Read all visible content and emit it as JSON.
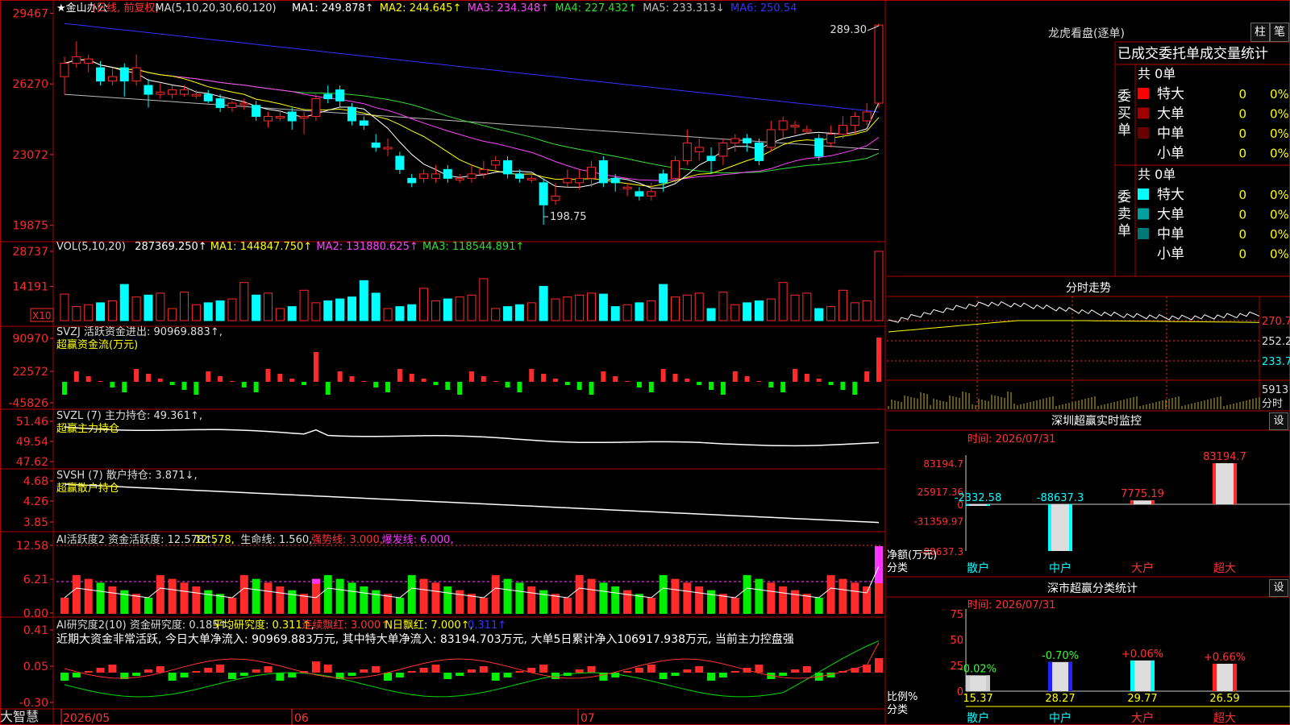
{
  "main": {
    "title": "★金山办公",
    "mode": "(日线, 前复权)",
    "ma_header": "MA(5,10,20,30,60,120)",
    "ma_values": [
      {
        "text": "MA1: 249.878↑",
        "color": "#ffffff"
      },
      {
        "text": "MA2: 244.645↑",
        "color": "#ffff00"
      },
      {
        "text": "MA3: 234.348↑",
        "color": "#ff44ff"
      },
      {
        "text": "MA4: 227.432↑",
        "color": "#33dd33"
      },
      {
        "text": "MA5: 233.313↓",
        "color": "#bbbbbb"
      },
      {
        "text": "MA6: 250.54",
        "color": "#3333ff"
      }
    ],
    "y_ticks": [
      "29467",
      "26270",
      "23072",
      "19875"
    ],
    "high_label": "289.30",
    "low_label": "198.75"
  },
  "volume": {
    "header": "VOL(5,10,20)",
    "values": [
      {
        "text": "287369.250↑",
        "color": "#ffffff"
      },
      {
        "text": "MA1: 144847.750↑",
        "color": "#ffff00"
      },
      {
        "text": "MA2: 131880.625↑",
        "color": "#ff44ff"
      },
      {
        "text": "MA3: 118544.891↑",
        "color": "#33dd33"
      }
    ],
    "y_ticks": [
      "28737",
      "14191"
    ],
    "unit": "X10"
  },
  "svzj": {
    "title": "SVZJ  活跃资金进出: 90969.883↑,",
    "subtitle": "超赢资金流(万元)",
    "y_ticks": [
      "90970",
      "22572",
      "-45826"
    ]
  },
  "svzl": {
    "title": "SVZL (7) 主力持仓: 49.361↑,",
    "subtitle": "超赢主力持仓",
    "y_ticks": [
      "51.46",
      "49.54",
      "47.62"
    ]
  },
  "svsh": {
    "title": "SVSH (7) 散户持仓: 3.871↓,",
    "subtitle": "超赢散户持仓",
    "y_ticks": [
      "4.68",
      "4.26",
      "3.85"
    ]
  },
  "ai_active": {
    "title": "AI活跃度2 资金活跃度: 12.578↑,",
    "v2": "12.578,",
    "v3": "生命线: 1.560,",
    "v4": "强势线: 3.000,",
    "v5": "爆发线: 6.000,",
    "y_ticks": [
      "12.58",
      "6.21",
      "0.00"
    ]
  },
  "ai_research": {
    "title": "AI研究度2(10) 资金研究度: 0.185↑,",
    "v2": "平均研究度: 0.311↑,",
    "v3": "连续飘红: 3.000↑,",
    "v4": "N日飘红: 7.000↑,",
    "v5": "0.311↑",
    "note": "近期大资金非常活跃, 今日大单净流入: 90969.883万元, 其中特大单净流入: 83194.703万元, 大单5日累计净入106917.938万元, 当前主力控盘强",
    "y_ticks": [
      "0.41",
      "0.05",
      "-0.30"
    ]
  },
  "x_axis": {
    "labels": [
      "2026/05",
      "06",
      "07"
    ],
    "brand": "大智慧"
  },
  "right": {
    "lhb_title": "龙虎看盘(逐单)",
    "btn1": "柱",
    "btn2": "笔",
    "stat_header": "已成交委托单成交量统计",
    "buy_label": "委买单",
    "sell_label": "委卖单",
    "buy_total": "共 0单",
    "sell_total": "共 0单",
    "buy_rows": [
      {
        "label": "特大",
        "v": "0",
        "p": "0%",
        "color": "#ff0000"
      },
      {
        "label": "大单",
        "v": "0",
        "p": "0%",
        "color": "#a00000"
      },
      {
        "label": "中单",
        "v": "0",
        "p": "0%",
        "color": "#6a0000"
      },
      {
        "label": "小单",
        "v": "0",
        "p": "0%",
        "color": ""
      }
    ],
    "sell_rows": [
      {
        "label": "特大",
        "v": "0",
        "p": "0%",
        "color": "#00ffff"
      },
      {
        "label": "大单",
        "v": "0",
        "p": "0%",
        "color": "#00a0a0"
      },
      {
        "label": "中单",
        "v": "0",
        "p": "0%",
        "color": "#007878"
      },
      {
        "label": "小单",
        "v": "0",
        "p": "0%",
        "color": ""
      }
    ],
    "intraday": {
      "title": "分时走势",
      "ticks": [
        "270.7",
        "252.2",
        "233.7"
      ],
      "vol": "5913",
      "vol_unit": "分时"
    },
    "sz_monitor": {
      "title": "深圳超赢实时监控",
      "btn": "设",
      "time": "时间: 2026/07/31",
      "y_ticks": [
        "83194.7",
        "25917.36",
        "0",
        "-31359.97",
        "-88637.3"
      ],
      "bars": [
        {
          "cat": "散户",
          "v": -2332.58,
          "label": "-2332.58"
        },
        {
          "cat": "中户",
          "v": -88637.3,
          "label": "-88637.3"
        },
        {
          "cat": "大户",
          "v": 7775.19,
          "label": "7775.19"
        },
        {
          "cat": "超大",
          "v": 83194.7,
          "label": "83194.7"
        }
      ],
      "ylabel": "净额(万元)",
      "xlabel": "分类"
    },
    "sz_classify": {
      "title": "深市超赢分类统计",
      "btn": "设",
      "time": "时间: 2026/07/31",
      "y_ticks": [
        "75",
        "50",
        "25",
        "0"
      ],
      "bars": [
        {
          "cat": "散户",
          "v": 15.37,
          "label": "15.37",
          "chg": "-0.02%",
          "chg_color": "#33ff33",
          "color": "#cccccc"
        },
        {
          "cat": "中户",
          "v": 28.27,
          "label": "28.27",
          "chg": "-0.70%",
          "chg_color": "#33ff33",
          "color": "#2222ff"
        },
        {
          "cat": "大户",
          "v": 29.77,
          "label": "29.77",
          "chg": "+0.06%",
          "chg_color": "#ff3333",
          "color": "#00ffff"
        },
        {
          "cat": "超大",
          "v": 26.59,
          "label": "26.59",
          "chg": "+0.66%",
          "chg_color": "#ff3333",
          "color": "#ff2222"
        }
      ],
      "ylabel": "比例%",
      "xlabel": "分类"
    }
  },
  "chart_data": {
    "type": "candlestick",
    "x_labels": [
      "2026/05",
      "06",
      "07"
    ],
    "price_ylim": [
      198.75,
      294.67
    ],
    "candles": [
      {
        "o": 266,
        "c": 272,
        "h": 275,
        "l": 258
      },
      {
        "o": 272,
        "c": 275,
        "h": 282,
        "l": 270
      },
      {
        "o": 272,
        "c": 274,
        "h": 276,
        "l": 268
      },
      {
        "o": 270,
        "c": 264,
        "h": 273,
        "l": 262
      },
      {
        "o": 264,
        "c": 266,
        "h": 270,
        "l": 262
      },
      {
        "o": 270,
        "c": 264,
        "h": 272,
        "l": 257
      },
      {
        "o": 264,
        "c": 270,
        "h": 276,
        "l": 262
      },
      {
        "o": 262,
        "c": 258,
        "h": 265,
        "l": 252
      },
      {
        "o": 258,
        "c": 259,
        "h": 263,
        "l": 256
      },
      {
        "o": 258,
        "c": 260,
        "h": 262,
        "l": 256
      },
      {
        "o": 258,
        "c": 260,
        "h": 262,
        "l": 257
      },
      {
        "o": 258,
        "c": 258,
        "h": 260,
        "l": 256
      },
      {
        "o": 258,
        "c": 255,
        "h": 260,
        "l": 254
      },
      {
        "o": 256,
        "c": 252,
        "h": 258,
        "l": 250
      },
      {
        "o": 252,
        "c": 254,
        "h": 255,
        "l": 250
      },
      {
        "o": 254,
        "c": 254,
        "h": 256,
        "l": 251
      },
      {
        "o": 253,
        "c": 248,
        "h": 255,
        "l": 246
      },
      {
        "o": 246,
        "c": 248,
        "h": 250,
        "l": 243
      },
      {
        "o": 248,
        "c": 248,
        "h": 250,
        "l": 246
      },
      {
        "o": 250,
        "c": 246,
        "h": 252,
        "l": 242
      },
      {
        "o": 248,
        "c": 248,
        "h": 250,
        "l": 240
      },
      {
        "o": 248,
        "c": 256,
        "h": 258,
        "l": 246
      },
      {
        "o": 258,
        "c": 256,
        "h": 262,
        "l": 254
      },
      {
        "o": 260,
        "c": 255,
        "h": 262,
        "l": 252
      },
      {
        "o": 252,
        "c": 246,
        "h": 254,
        "l": 244
      },
      {
        "o": 246,
        "c": 244,
        "h": 248,
        "l": 242
      },
      {
        "o": 236,
        "c": 234,
        "h": 240,
        "l": 232
      },
      {
        "o": 234,
        "c": 234,
        "h": 238,
        "l": 230
      },
      {
        "o": 230,
        "c": 224,
        "h": 232,
        "l": 222
      },
      {
        "o": 220,
        "c": 218,
        "h": 222,
        "l": 216
      },
      {
        "o": 220,
        "c": 222,
        "h": 224,
        "l": 218
      },
      {
        "o": 220,
        "c": 222,
        "h": 226,
        "l": 218
      },
      {
        "o": 224,
        "c": 220,
        "h": 226,
        "l": 218
      },
      {
        "o": 220,
        "c": 220,
        "h": 222,
        "l": 218
      },
      {
        "o": 220,
        "c": 222,
        "h": 226,
        "l": 218
      },
      {
        "o": 222,
        "c": 224,
        "h": 228,
        "l": 220
      },
      {
        "o": 226,
        "c": 228,
        "h": 230,
        "l": 224
      },
      {
        "o": 228,
        "c": 222,
        "h": 230,
        "l": 220
      },
      {
        "o": 222,
        "c": 220,
        "h": 224,
        "l": 218
      },
      {
        "o": 220,
        "c": 220,
        "h": 222,
        "l": 218
      },
      {
        "o": 218,
        "c": 208,
        "h": 220,
        "l": 199
      },
      {
        "o": 210,
        "c": 212,
        "h": 218,
        "l": 208
      },
      {
        "o": 218,
        "c": 220,
        "h": 224,
        "l": 216
      },
      {
        "o": 218,
        "c": 220,
        "h": 224,
        "l": 215
      },
      {
        "o": 220,
        "c": 225,
        "h": 228,
        "l": 216
      },
      {
        "o": 228,
        "c": 218,
        "h": 230,
        "l": 216
      },
      {
        "o": 220,
        "c": 218,
        "h": 222,
        "l": 214
      },
      {
        "o": 216,
        "c": 216,
        "h": 218,
        "l": 212
      },
      {
        "o": 214,
        "c": 212,
        "h": 216,
        "l": 210
      },
      {
        "o": 212,
        "c": 214,
        "h": 218,
        "l": 210
      },
      {
        "o": 222,
        "c": 218,
        "h": 224,
        "l": 214
      },
      {
        "o": 220,
        "c": 228,
        "h": 230,
        "l": 218
      },
      {
        "o": 228,
        "c": 236,
        "h": 242,
        "l": 226
      },
      {
        "o": 232,
        "c": 234,
        "h": 238,
        "l": 228
      },
      {
        "o": 230,
        "c": 228,
        "h": 234,
        "l": 222
      },
      {
        "o": 230,
        "c": 236,
        "h": 238,
        "l": 226
      },
      {
        "o": 236,
        "c": 238,
        "h": 240,
        "l": 232
      },
      {
        "o": 238,
        "c": 236,
        "h": 240,
        "l": 232
      },
      {
        "o": 236,
        "c": 228,
        "h": 238,
        "l": 226
      },
      {
        "o": 234,
        "c": 242,
        "h": 246,
        "l": 232
      },
      {
        "o": 242,
        "c": 246,
        "h": 248,
        "l": 238
      },
      {
        "o": 244,
        "c": 244,
        "h": 246,
        "l": 240
      },
      {
        "o": 242,
        "c": 242,
        "h": 244,
        "l": 240
      },
      {
        "o": 238,
        "c": 230,
        "h": 240,
        "l": 228
      },
      {
        "o": 236,
        "c": 240,
        "h": 244,
        "l": 234
      },
      {
        "o": 240,
        "c": 244,
        "h": 248,
        "l": 238
      },
      {
        "o": 244,
        "c": 248,
        "h": 250,
        "l": 240
      },
      {
        "o": 246,
        "c": 250,
        "h": 254,
        "l": 244
      },
      {
        "o": 254,
        "c": 289.3,
        "h": 290,
        "l": 252
      }
    ]
  }
}
